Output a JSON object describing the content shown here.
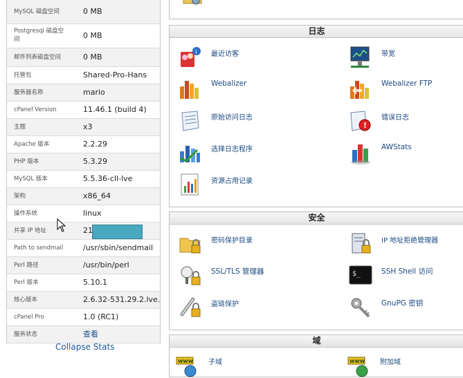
{
  "stats": {
    "rows": [
      {
        "label": "MySQL 磁盘空间",
        "value": "0 MB"
      },
      {
        "label": "Postgresql 磁盘空间",
        "value": "0 MB"
      },
      {
        "label": "邮件列表磁盘空间",
        "value": "0 MB"
      },
      {
        "label": "托管包",
        "value": "Shared-Pro-Hans"
      },
      {
        "label": "服务器名称",
        "value": "mario"
      },
      {
        "label": "cPanel Version",
        "value": "11.46.1 (build 4)"
      },
      {
        "label": "主题",
        "value": "x3"
      },
      {
        "label": "Apache 版本",
        "value": "2.2.29"
      },
      {
        "label": "PHP 版本",
        "value": "5.3.29"
      },
      {
        "label": "MySQL 版本",
        "value": "5.5.36-cll-lve"
      },
      {
        "label": "架构",
        "value": "x86_64"
      },
      {
        "label": "操作系统",
        "value": "linux"
      },
      {
        "label": "共享 IP 地址",
        "value": "216."
      },
      {
        "label": "Path to sendmail",
        "value": "/usr/sbin/sendmail"
      },
      {
        "label": "Perl 路径",
        "value": "/usr/bin/perl"
      },
      {
        "label": "Perl 版本",
        "value": "5.10.1"
      },
      {
        "label": "核心版本",
        "value": "2.6.32-531.29.2.lve..."
      },
      {
        "label": "cPanel Pro",
        "value": "1.0 (RC1)"
      },
      {
        "label": "服务状态",
        "value": "查看"
      }
    ],
    "collapse_label": "Collapse Stats"
  },
  "sections": {
    "logs": {
      "title": "日志",
      "items": [
        {
          "label": "最近访客",
          "icon": "visitors-icon"
        },
        {
          "label": "带宽",
          "icon": "bandwidth-icon"
        },
        {
          "label": "Webalizer",
          "icon": "webalizer-icon"
        },
        {
          "label": "Webalizer FTP",
          "icon": "webalizer-ftp-icon"
        },
        {
          "label": "原始访问日志",
          "icon": "raw-log-icon"
        },
        {
          "label": "错误日志",
          "icon": "error-log-icon"
        },
        {
          "label": "选择日志程序",
          "icon": "log-program-icon"
        },
        {
          "label": "AWStats",
          "icon": "awstats-icon"
        },
        {
          "label": "资源占用记录",
          "icon": "resource-usage-icon"
        }
      ]
    },
    "security": {
      "title": "安全",
      "items": [
        {
          "label": "密码保护目录",
          "icon": "password-dir-icon"
        },
        {
          "label": "IP 地址拒绝管理器",
          "icon": "ip-deny-icon"
        },
        {
          "label": "SSL/TLS 管理器",
          "icon": "ssl-icon"
        },
        {
          "label": "SSH Shell 访问",
          "icon": "ssh-icon"
        },
        {
          "label": "盗链保护",
          "icon": "hotlink-icon"
        },
        {
          "label": "GnuPG 密钥",
          "icon": "gnupg-icon"
        }
      ]
    },
    "domains": {
      "title": "域",
      "items": [
        {
          "label": "子域",
          "icon": "subdomain-icon"
        },
        {
          "label": "附加域",
          "icon": "addon-domain-icon"
        }
      ]
    }
  }
}
